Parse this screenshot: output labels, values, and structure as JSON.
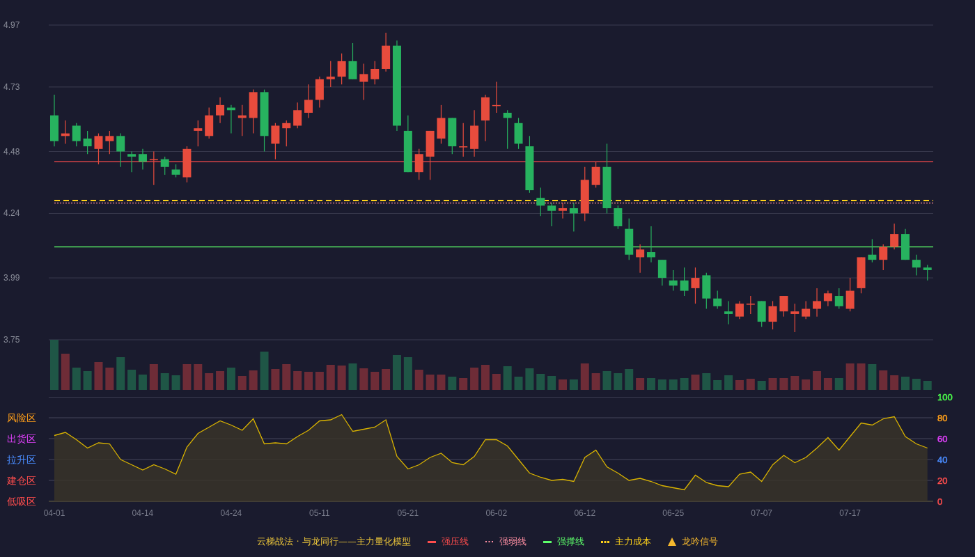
{
  "price_chart": {
    "chart_data": {
      "type": "candlestick",
      "grid": true,
      "ylim": [
        3.75,
        4.97
      ],
      "yticks": [
        3.75,
        3.99,
        4.24,
        4.48,
        4.73,
        4.97
      ],
      "categories": [
        null,
        null,
        null,
        null,
        null,
        null,
        null,
        null,
        null,
        null,
        null,
        null,
        null,
        null,
        null,
        null,
        null,
        null,
        null,
        null,
        null,
        null,
        null,
        null,
        null,
        null,
        null,
        null,
        null,
        null,
        null,
        null,
        null,
        null,
        null,
        null,
        null,
        null,
        null,
        null,
        null,
        null,
        null,
        null,
        null,
        null,
        null,
        null,
        null,
        null,
        null,
        null,
        null,
        null,
        null,
        null,
        null,
        null,
        null,
        null,
        null,
        null,
        null,
        null,
        null,
        null,
        null,
        null,
        null,
        null,
        null,
        null,
        null,
        null,
        null,
        null,
        null,
        null,
        null,
        null
      ],
      "ohlc": [
        [
          4.62,
          4.7,
          4.5,
          4.52
        ],
        [
          4.54,
          4.6,
          4.51,
          4.55
        ],
        [
          4.58,
          4.59,
          4.5,
          4.52
        ],
        [
          4.53,
          4.56,
          4.47,
          4.5
        ],
        [
          4.49,
          4.55,
          4.43,
          4.54
        ],
        [
          4.52,
          4.56,
          4.47,
          4.54
        ],
        [
          4.54,
          4.55,
          4.42,
          4.48
        ],
        [
          4.47,
          4.48,
          4.4,
          4.46
        ],
        [
          4.47,
          4.49,
          4.41,
          4.44
        ],
        [
          4.45,
          4.48,
          4.35,
          4.45
        ],
        [
          4.45,
          4.46,
          4.39,
          4.42
        ],
        [
          4.41,
          4.43,
          4.38,
          4.39
        ],
        [
          4.38,
          4.5,
          4.36,
          4.49
        ],
        [
          4.56,
          4.6,
          4.5,
          4.57
        ],
        [
          4.54,
          4.65,
          4.53,
          4.62
        ],
        [
          4.62,
          4.69,
          4.59,
          4.66
        ],
        [
          4.65,
          4.66,
          4.55,
          4.64
        ],
        [
          4.61,
          4.66,
          4.54,
          4.62
        ],
        [
          4.61,
          4.72,
          4.55,
          4.71
        ],
        [
          4.71,
          4.72,
          4.48,
          4.54
        ],
        [
          4.51,
          4.59,
          4.45,
          4.58
        ],
        [
          4.57,
          4.6,
          4.5,
          4.59
        ],
        [
          4.58,
          4.67,
          4.57,
          4.64
        ],
        [
          4.63,
          4.74,
          4.61,
          4.68
        ],
        [
          4.68,
          4.77,
          4.65,
          4.76
        ],
        [
          4.76,
          4.83,
          4.73,
          4.77
        ],
        [
          4.77,
          4.86,
          4.74,
          4.83
        ],
        [
          4.83,
          4.9,
          4.76,
          4.76
        ],
        [
          4.75,
          4.82,
          4.68,
          4.78
        ],
        [
          4.76,
          4.83,
          4.74,
          4.8
        ],
        [
          4.8,
          4.94,
          4.79,
          4.89
        ],
        [
          4.89,
          4.91,
          4.56,
          4.58
        ],
        [
          4.56,
          4.62,
          4.4,
          4.4
        ],
        [
          4.4,
          4.49,
          4.37,
          4.47
        ],
        [
          4.46,
          4.56,
          4.37,
          4.56
        ],
        [
          4.53,
          4.66,
          4.51,
          4.61
        ],
        [
          4.61,
          4.61,
          4.47,
          4.5
        ],
        [
          4.5,
          4.59,
          4.46,
          4.5
        ],
        [
          4.49,
          4.64,
          4.46,
          4.58
        ],
        [
          4.6,
          4.7,
          4.52,
          4.69
        ],
        [
          4.66,
          4.75,
          4.63,
          4.66
        ],
        [
          4.63,
          4.64,
          4.49,
          4.61
        ],
        [
          4.59,
          4.61,
          4.49,
          4.51
        ],
        [
          4.5,
          4.54,
          4.32,
          4.33
        ],
        [
          4.3,
          4.34,
          4.23,
          4.27
        ],
        [
          4.27,
          4.28,
          4.19,
          4.25
        ],
        [
          4.25,
          4.28,
          4.22,
          4.26
        ],
        [
          4.26,
          4.28,
          4.17,
          4.24
        ],
        [
          4.24,
          4.42,
          4.21,
          4.37
        ],
        [
          4.35,
          4.44,
          4.34,
          4.42
        ],
        [
          4.42,
          4.51,
          4.24,
          4.26
        ],
        [
          4.26,
          4.27,
          4.18,
          4.19
        ],
        [
          4.18,
          4.22,
          4.06,
          4.08
        ],
        [
          4.07,
          4.12,
          4.01,
          4.1
        ],
        [
          4.09,
          4.19,
          4.05,
          4.07
        ],
        [
          4.06,
          4.06,
          3.96,
          3.99
        ],
        [
          3.98,
          4.02,
          3.94,
          3.96
        ],
        [
          3.98,
          4.03,
          3.92,
          3.94
        ],
        [
          3.95,
          4.03,
          3.89,
          3.99
        ],
        [
          4.0,
          4.01,
          3.87,
          3.91
        ],
        [
          3.91,
          3.94,
          3.87,
          3.88
        ],
        [
          3.86,
          3.9,
          3.81,
          3.85
        ],
        [
          3.84,
          3.9,
          3.83,
          3.89
        ],
        [
          3.89,
          3.92,
          3.85,
          3.89
        ],
        [
          3.9,
          3.9,
          3.8,
          3.82
        ],
        [
          3.82,
          3.9,
          3.79,
          3.88
        ],
        [
          3.86,
          3.92,
          3.84,
          3.92
        ],
        [
          3.85,
          3.89,
          3.78,
          3.86
        ],
        [
          3.84,
          3.9,
          3.83,
          3.87
        ],
        [
          3.87,
          3.95,
          3.84,
          3.9
        ],
        [
          3.9,
          3.94,
          3.88,
          3.93
        ],
        [
          3.92,
          3.95,
          3.87,
          3.88
        ],
        [
          3.87,
          3.99,
          3.86,
          3.94
        ],
        [
          3.95,
          4.07,
          3.93,
          4.07
        ],
        [
          4.08,
          4.14,
          4.05,
          4.06
        ],
        [
          4.06,
          4.12,
          4.02,
          4.11
        ],
        [
          4.11,
          4.2,
          4.1,
          4.16
        ],
        [
          4.16,
          4.18,
          4.06,
          4.06
        ],
        [
          4.06,
          4.08,
          4.0,
          4.03
        ],
        [
          4.03,
          4.04,
          3.98,
          4.02
        ]
      ],
      "ref_lines": [
        {
          "axis": "y",
          "value": 4.44,
          "color": "#ff4d4d"
        },
        {
          "axis": "y",
          "value": 4.29,
          "color": "#ffd21a"
        },
        {
          "axis": "y",
          "value": 4.28,
          "color": "#ff8fa3"
        },
        {
          "axis": "y",
          "value": 4.11,
          "color": "#5dff6a"
        }
      ]
    }
  },
  "indicator_chart": {
    "zones": [
      {
        "label": "风险区",
        "color": "#ff9f1a"
      },
      {
        "label": "出货区",
        "color": "#e040fb"
      },
      {
        "label": "拉升区",
        "color": "#4a8cff"
      },
      {
        "label": "建仓区",
        "color": "#ff4d4d"
      },
      {
        "label": "低吸区",
        "color": "#ff4d4d"
      }
    ],
    "axis_labels": [
      {
        "label": "100",
        "color": "#4cff4c"
      },
      {
        "label": "80",
        "color": "#ff9f1a"
      },
      {
        "label": "60",
        "color": "#e040fb"
      },
      {
        "label": "40",
        "color": "#4a8cff"
      },
      {
        "label": "20",
        "color": "#ff4d4d"
      },
      {
        "label": "0",
        "color": "#ff4d4d"
      }
    ],
    "chart_data": {
      "type": "area",
      "grid": true,
      "ylim": [
        0,
        100
      ],
      "yticks": [
        100,
        80,
        60,
        40,
        20,
        0
      ],
      "categories": [
        "04-01",
        null,
        null,
        null,
        null,
        null,
        null,
        null,
        "04-14",
        null,
        null,
        null,
        null,
        null,
        null,
        null,
        "04-24",
        null,
        null,
        null,
        null,
        null,
        null,
        null,
        "05-11",
        null,
        null,
        null,
        null,
        null,
        null,
        null,
        "05-21",
        null,
        null,
        null,
        null,
        null,
        null,
        null,
        "06-02",
        null,
        null,
        null,
        null,
        null,
        null,
        null,
        "06-12",
        null,
        null,
        null,
        null,
        null,
        null,
        null,
        "06-25",
        null,
        null,
        null,
        null,
        null,
        null,
        null,
        "07-07",
        null,
        null,
        null,
        null,
        null,
        null,
        null,
        "07-17",
        null,
        null,
        null,
        null,
        null,
        null,
        null
      ],
      "series": [
        {
          "color": "#d9b300",
          "values": [
            63,
            66,
            59,
            51,
            56,
            55,
            40,
            35,
            30,
            35,
            31,
            26,
            52,
            65,
            71,
            77,
            73,
            68,
            79,
            55,
            56,
            55,
            62,
            68,
            77,
            78,
            83,
            67,
            69,
            71,
            78,
            43,
            31,
            35,
            42,
            46,
            37,
            35,
            43,
            59,
            59,
            53,
            40,
            27,
            23,
            20,
            21,
            19,
            42,
            49,
            33,
            27,
            20,
            22,
            19,
            15,
            13,
            11,
            25,
            18,
            15,
            14,
            26,
            28,
            19,
            35,
            44,
            37,
            42,
            51,
            61,
            49,
            62,
            75,
            73,
            79,
            81,
            62,
            55,
            51
          ]
        }
      ]
    }
  },
  "legend": {
    "title": "云梯战法 · 与龙同行——主力量化模型",
    "items": [
      {
        "kind": "solid",
        "label": "强压线",
        "color": "#ff4d4d"
      },
      {
        "kind": "dotted",
        "label": "强弱线",
        "color": "#ff8fa3"
      },
      {
        "kind": "solid",
        "label": "强撑线",
        "color": "#5dff6a"
      },
      {
        "kind": "dashed",
        "label": "主力成本",
        "color": "#ffd21a"
      },
      {
        "kind": "triangle",
        "label": "龙吟信号",
        "color": "#f5b82e"
      }
    ]
  }
}
